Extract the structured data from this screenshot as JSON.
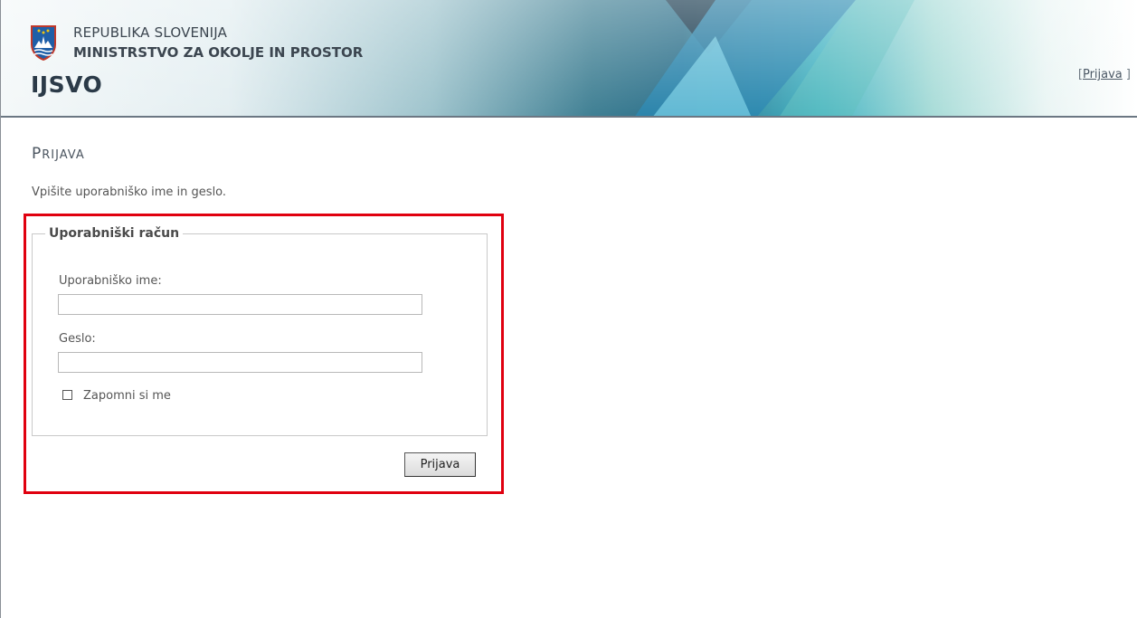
{
  "header": {
    "org_line1": "REPUBLIKA SLOVENIJA",
    "org_line2": "MINISTRSTVO ZA OKOLJE IN PROSTOR",
    "app_title": "IJSVO",
    "bracket_open": "[",
    "login_link": "Prijava",
    "bracket_close": " ]",
    "logo_icon": "slovenia-coat-of-arms-icon"
  },
  "main": {
    "heading_first": "P",
    "heading_rest": "RIJAVA",
    "instruction": "Vpišite uporabniško ime in geslo.",
    "fieldset_legend": "Uporabniški račun",
    "username_label": "Uporabniško ime:",
    "username_value": "",
    "password_label": "Geslo:",
    "password_value": "",
    "remember_label": "Zapomni si me",
    "remember_checked": false,
    "submit_label": "Prijava"
  },
  "colors": {
    "highlight_border": "#e0000f",
    "header_teal": "#1f8fb0",
    "header_dark": "#1a3f55"
  }
}
